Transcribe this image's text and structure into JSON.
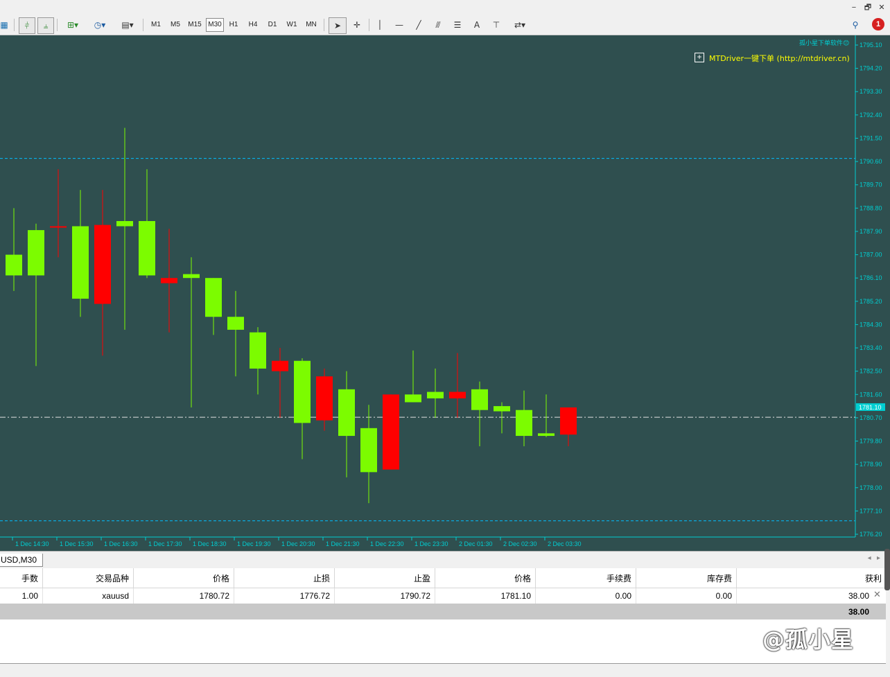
{
  "window": {
    "minimize": "−",
    "restore": "🗗",
    "close": "✕"
  },
  "toolbar": {
    "timeframes": [
      "M1",
      "M5",
      "M15",
      "M30",
      "H1",
      "H4",
      "D1",
      "W1",
      "MN"
    ],
    "active_timeframe": "M30",
    "notification_count": "1"
  },
  "chart": {
    "top_right_label": "孤小星下单软件😊",
    "mtdriver_label": "MTDriver一键下单 (http://mtdriver.cn)",
    "mtdriver_button": "+",
    "current_price_tag": "1781.10",
    "price_axis_labels": [
      "1795.10",
      "1794.20",
      "1793.30",
      "1792.40",
      "1791.50",
      "1790.60",
      "1789.70",
      "1788.80",
      "1787.90",
      "1787.00",
      "1786.10",
      "1785.20",
      "1784.30",
      "1783.40",
      "1782.50",
      "1781.60",
      "1780.70",
      "1779.80",
      "1778.90",
      "1778.00",
      "1777.10",
      "1776.20"
    ],
    "time_axis_labels": [
      "1 Dec 14:30",
      "1 Dec 15:30",
      "1 Dec 16:30",
      "1 Dec 17:30",
      "1 Dec 18:30",
      "1 Dec 19:30",
      "1 Dec 20:30",
      "1 Dec 21:30",
      "1 Dec 22:30",
      "1 Dec 23:30",
      "2 Dec 01:30",
      "2 Dec 02:30",
      "2 Dec 03:30"
    ],
    "up_color": "#7cfc00",
    "down_color": "#ff0000",
    "background": "#2f4f4f",
    "axis_color": "#00ced1",
    "sl_line": 1776.72,
    "tp_line": 1790.72,
    "entry_line": 1780.72
  },
  "chart_tab": "USD,M30",
  "terminal": {
    "headers": [
      "手数",
      "交易品种",
      "价格",
      "止损",
      "止盈",
      "价格",
      "手续费",
      "库存费",
      "获利"
    ],
    "rows": [
      [
        "1.00",
        "xauusd",
        "1780.72",
        "1776.72",
        "1790.72",
        "1781.10",
        "0.00",
        "0.00",
        "38.00"
      ]
    ],
    "total": "38.00",
    "close_icon": "✕"
  },
  "watermark": "@孤小星",
  "chart_data": {
    "type": "candlestick",
    "candles": [
      {
        "o": 1786.2,
        "h": 1788.8,
        "l": 1785.6,
        "c": 1787.0
      },
      {
        "o": 1786.2,
        "h": 1788.2,
        "l": 1782.7,
        "c": 1787.95
      },
      {
        "o": 1788.1,
        "h": 1790.3,
        "l": 1786.9,
        "c": 1788.05
      },
      {
        "o": 1785.3,
        "h": 1789.5,
        "l": 1784.6,
        "c": 1788.1
      },
      {
        "o": 1788.15,
        "h": 1789.5,
        "l": 1783.1,
        "c": 1785.1
      },
      {
        "o": 1788.1,
        "h": 1791.9,
        "l": 1784.1,
        "c": 1788.3
      },
      {
        "o": 1786.2,
        "h": 1790.3,
        "l": 1786.1,
        "c": 1788.3
      },
      {
        "o": 1786.1,
        "h": 1788.0,
        "l": 1784.0,
        "c": 1785.9
      },
      {
        "o": 1786.1,
        "h": 1786.9,
        "l": 1781.1,
        "c": 1786.25
      },
      {
        "o": 1784.6,
        "h": 1786.1,
        "l": 1783.9,
        "c": 1786.1
      },
      {
        "o": 1784.1,
        "h": 1785.6,
        "l": 1782.3,
        "c": 1784.6
      },
      {
        "o": 1782.6,
        "h": 1784.2,
        "l": 1781.6,
        "c": 1784.0
      },
      {
        "o": 1782.9,
        "h": 1783.4,
        "l": 1780.7,
        "c": 1782.5
      },
      {
        "o": 1780.5,
        "h": 1783.0,
        "l": 1779.1,
        "c": 1782.9
      },
      {
        "o": 1782.3,
        "h": 1782.6,
        "l": 1780.2,
        "c": 1780.6
      },
      {
        "o": 1780.0,
        "h": 1782.5,
        "l": 1778.4,
        "c": 1781.8
      },
      {
        "o": 1778.6,
        "h": 1781.2,
        "l": 1777.4,
        "c": 1780.3
      },
      {
        "o": 1781.6,
        "h": 1781.6,
        "l": 1778.7,
        "c": 1778.7
      },
      {
        "o": 1781.3,
        "h": 1783.3,
        "l": 1781.3,
        "c": 1781.6
      },
      {
        "o": 1781.45,
        "h": 1782.6,
        "l": 1780.7,
        "c": 1781.7
      },
      {
        "o": 1781.7,
        "h": 1783.2,
        "l": 1780.7,
        "c": 1781.45
      },
      {
        "o": 1781.0,
        "h": 1782.1,
        "l": 1779.6,
        "c": 1781.8
      },
      {
        "o": 1780.95,
        "h": 1781.3,
        "l": 1780.1,
        "c": 1781.15
      },
      {
        "o": 1780.0,
        "h": 1781.75,
        "l": 1779.6,
        "c": 1781.0
      },
      {
        "o": 1780.0,
        "h": 1781.6,
        "l": 1779.95,
        "c": 1780.1
      },
      {
        "o": 1781.1,
        "h": 1781.1,
        "l": 1779.6,
        "c": 1780.05
      }
    ],
    "ylim": [
      1776.2,
      1795.1
    ]
  }
}
